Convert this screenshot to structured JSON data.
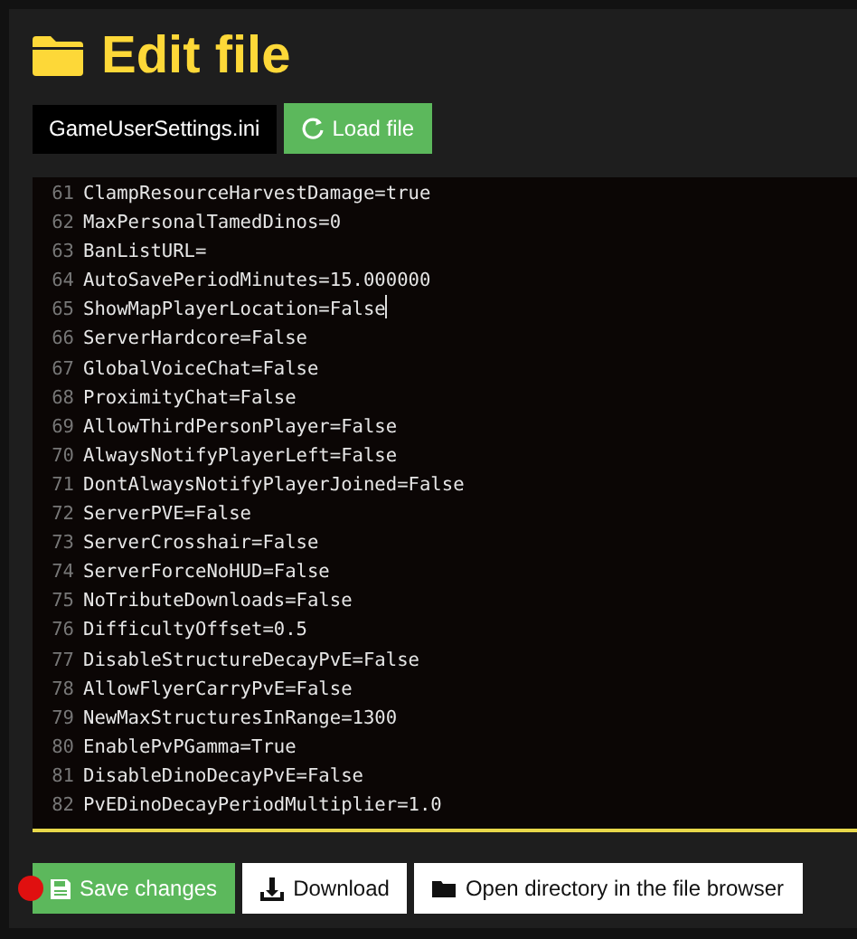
{
  "title": "Edit file",
  "file_name": "GameUserSettings.ini",
  "load_button": "Load file",
  "editor_lines": [
    {
      "number": "61",
      "text": "ClampResourceHarvestDamage=true",
      "cursor": false
    },
    {
      "number": "62",
      "text": "MaxPersonalTamedDinos=0",
      "cursor": false
    },
    {
      "number": "63",
      "text": "BanListURL=",
      "cursor": false
    },
    {
      "number": "64",
      "text": "AutoSavePeriodMinutes=15.000000",
      "cursor": false
    },
    {
      "number": "65",
      "text": "ShowMapPlayerLocation=False",
      "cursor": true
    },
    {
      "number": "66",
      "text": "ServerHardcore=False",
      "cursor": false
    },
    {
      "number": "67",
      "text": "GlobalVoiceChat=False",
      "cursor": false
    },
    {
      "number": "68",
      "text": "ProximityChat=False",
      "cursor": false
    },
    {
      "number": "69",
      "text": "AllowThirdPersonPlayer=False",
      "cursor": false
    },
    {
      "number": "70",
      "text": "AlwaysNotifyPlayerLeft=False",
      "cursor": false
    },
    {
      "number": "71",
      "text": "DontAlwaysNotifyPlayerJoined=False",
      "cursor": false
    },
    {
      "number": "72",
      "text": "ServerPVE=False",
      "cursor": false
    },
    {
      "number": "73",
      "text": "ServerCrosshair=False",
      "cursor": false
    },
    {
      "number": "74",
      "text": "ServerForceNoHUD=False",
      "cursor": false
    },
    {
      "number": "75",
      "text": "NoTributeDownloads=False",
      "cursor": false
    },
    {
      "number": "76",
      "text": "DifficultyOffset=0.5",
      "cursor": false
    },
    {
      "number": "77",
      "text": "DisableStructureDecayPvE=False",
      "cursor": false
    },
    {
      "number": "78",
      "text": "AllowFlyerCarryPvE=False",
      "cursor": false
    },
    {
      "number": "79",
      "text": "NewMaxStructuresInRange=1300",
      "cursor": false
    },
    {
      "number": "80",
      "text": "EnablePvPGamma=True",
      "cursor": false
    },
    {
      "number": "81",
      "text": "DisableDinoDecayPvE=False",
      "cursor": false
    },
    {
      "number": "82",
      "text": "PvEDinoDecayPeriodMultiplier=1.0",
      "cursor": false
    }
  ],
  "actions": [
    {
      "kind": "save",
      "label": "Save changes",
      "notification": true
    },
    {
      "kind": "download",
      "label": "Download",
      "notification": false
    },
    {
      "kind": "folder",
      "label": "Open directory in the file browser",
      "notification": false
    }
  ]
}
